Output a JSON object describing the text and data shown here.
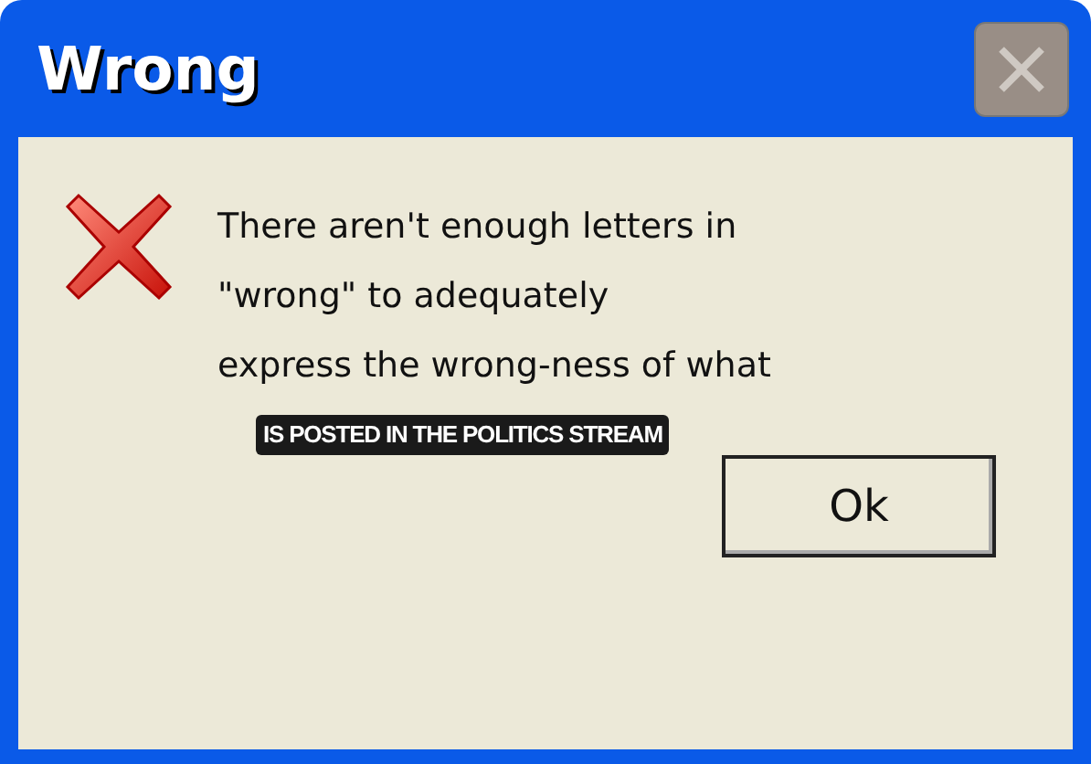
{
  "window": {
    "title": "Wrong",
    "close_button": {
      "disabled": true
    }
  },
  "message_lines": [
    "There aren't enough letters in",
    "\"wrong\" to adequately",
    "express the wrong-ness of what"
  ],
  "caption": "IS POSTED IN THE POLITICS STREAM",
  "buttons": [
    "Ok"
  ]
}
